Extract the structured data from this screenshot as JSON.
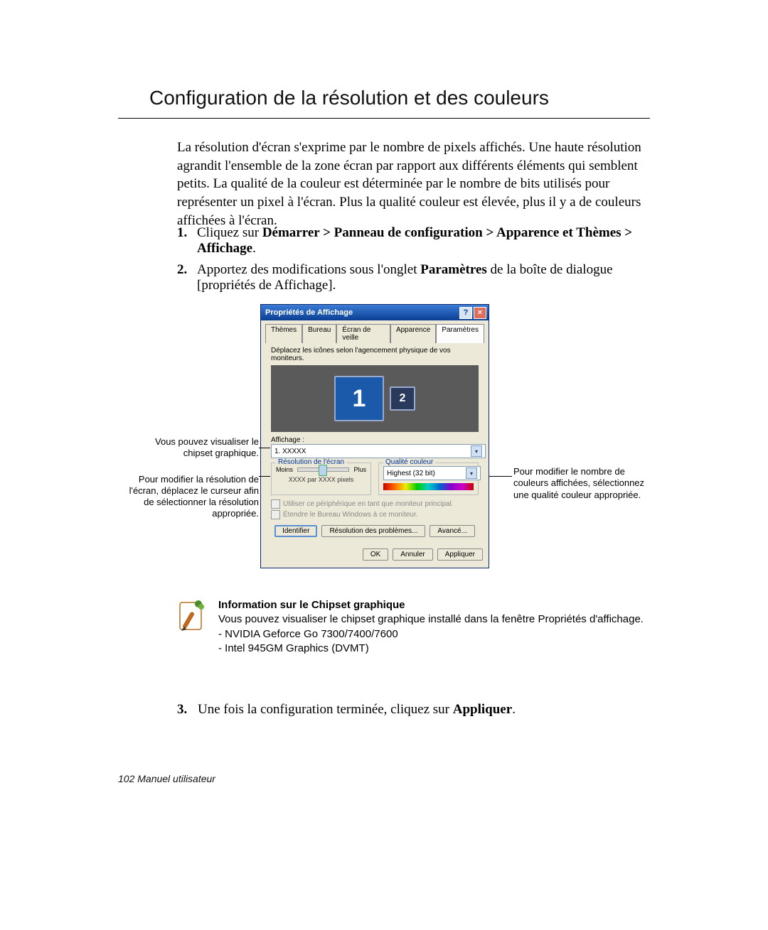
{
  "title": "Configuration de la résolution et des couleurs",
  "intro": "La résolution d'écran s'exprime par le nombre de pixels affichés. Une haute résolution agrandit l'ensemble de la zone écran par rapport aux différents éléments qui semblent petits. La qualité de la couleur est déterminée par le nombre de bits utilisés pour représenter un pixel à l'écran. Plus la qualité couleur est élevée, plus il y a de couleurs affichées à l'écran.",
  "steps": {
    "s1": {
      "num": "1.",
      "pre": "Cliquez sur ",
      "bold": "Démarrer > Panneau de configuration > Apparence et Thèmes > Affichage",
      "post": "."
    },
    "s2": {
      "num": "2.",
      "pre": "Apportez des modifications sous l'onglet ",
      "bold": "Paramètres",
      "post": " de la boîte de dialogue [propriétés de Affichage]."
    },
    "s3": {
      "num": "3.",
      "pre": "Une fois la configuration terminée, cliquez sur ",
      "bold": "Appliquer",
      "post": "."
    }
  },
  "dialog": {
    "title": "Propriétés de Affichage",
    "help": "?",
    "close": "×",
    "tabs": {
      "themes": "Thèmes",
      "bureau": "Bureau",
      "veille": "Écran de veille",
      "apparence": "Apparence",
      "parametres": "Paramètres"
    },
    "hint": "Déplacez les icônes selon l'agencement physique de vos moniteurs.",
    "mon1": "1",
    "mon2": "2",
    "display_label": "Affichage :",
    "display_value": "1. XXXXX",
    "res_legend": "Résolution de l'écran",
    "res_less": "Moins",
    "res_more": "Plus",
    "res_px": "XXXX par XXXX pixels",
    "qual_legend": "Qualité couleur",
    "qual_value": "Highest (32 bit)",
    "chk1": "Utiliser ce périphérique en tant que moniteur principal.",
    "chk2": "Étendre le Bureau Windows à ce moniteur.",
    "btn_id": "Identifier",
    "btn_trouble": "Résolution des problèmes...",
    "btn_adv": "Avancé...",
    "btn_ok": "OK",
    "btn_cancel": "Annuler",
    "btn_apply": "Appliquer"
  },
  "annot": {
    "left1": "Vous pouvez visualiser le chipset graphique.",
    "left2": "Pour modifier la résolution de l'écran, déplacez le curseur afin de sélectionner la résolution appropriée.",
    "right": "Pour modifier le nombre de couleurs affichées, sélectionnez une qualité couleur appropriée."
  },
  "info": {
    "heading": "Information sur le Chipset graphique",
    "body": "Vous pouvez visualiser le chipset graphique installé dans la fenêtre Propriétés d'affichage.",
    "l1": "- NVIDIA Geforce Go 7300/7400/7600",
    "l2": "- Intel 945GM Graphics (DVMT)"
  },
  "footer": "102  Manuel utilisateur"
}
